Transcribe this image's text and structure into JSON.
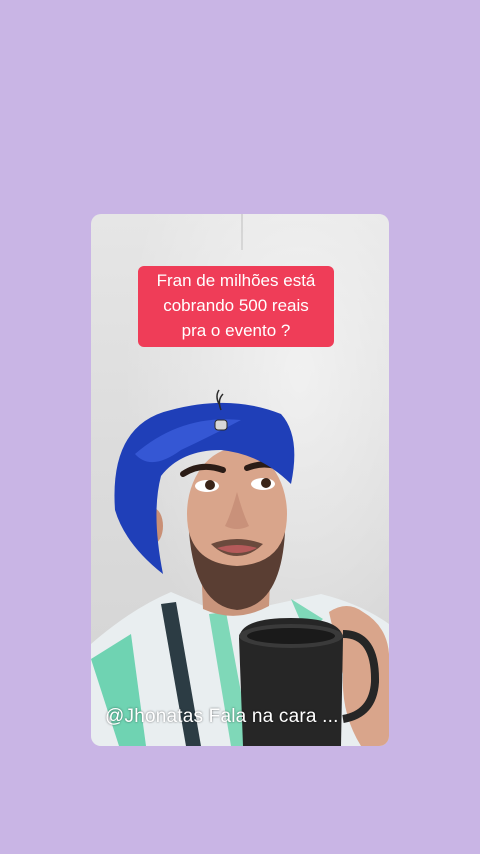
{
  "story": {
    "caption_lines": [
      "Fran de milhões está",
      "cobrando 500 reais",
      "pra o evento ?"
    ],
    "handle_text": "@Jhonatas Fala na cara ..."
  },
  "colors": {
    "background": "#c9b5e5",
    "caption_bg": "#ef3d58",
    "caption_text": "#ffffff",
    "bonnet": "#1f3fb8"
  }
}
